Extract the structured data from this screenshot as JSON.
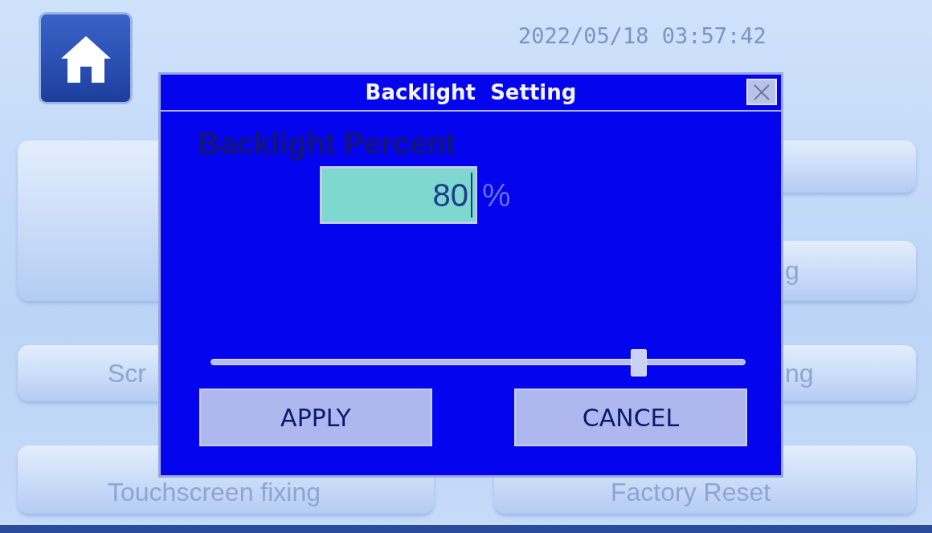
{
  "status_bar": {
    "datetime": "2022/05/18 03:57:42"
  },
  "menu": {
    "left_buttons": [
      "Scr",
      "Touchscreen fixing"
    ],
    "right_buttons": [
      "g",
      "ng",
      "Factory Reset"
    ]
  },
  "dialog": {
    "title": "Backlight  Setting",
    "label": "Backlight Percent",
    "value": "80",
    "unit": "%",
    "level": 0.8,
    "buttons": [
      "APPLY",
      "CANCEL"
    ]
  }
}
